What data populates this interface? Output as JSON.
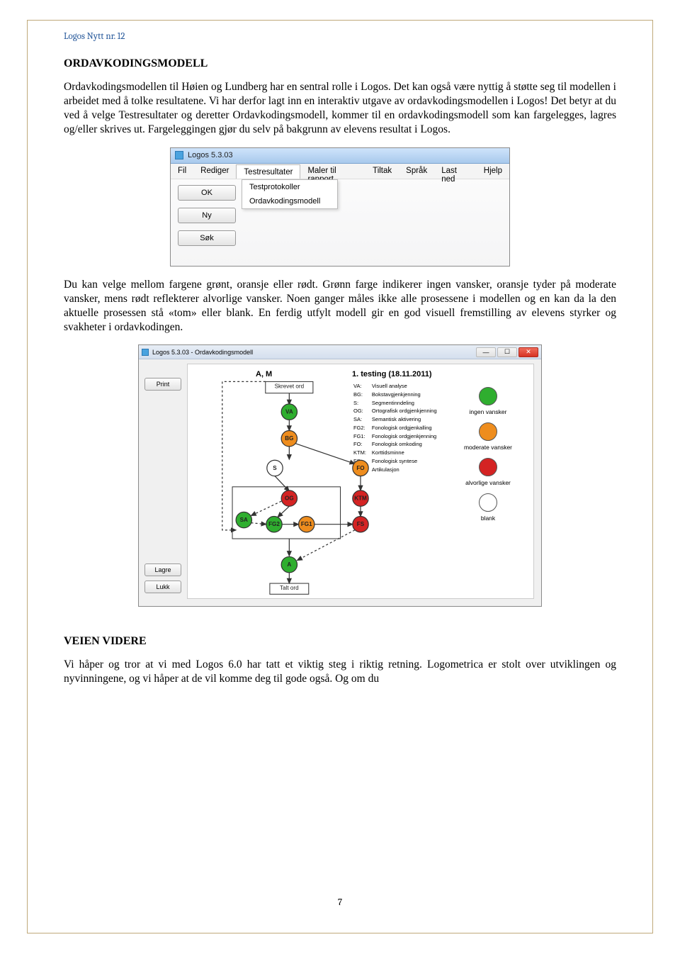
{
  "doc_header": "Logos Nytt nr. 12",
  "page_number": "7",
  "section1_title": "ORDAVKODINGSMODELL",
  "para1": "Ordavkodingsmodellen til Høien og Lundberg har en sentral rolle i Logos. Det kan også være nyttig å støtte seg til modellen i arbeidet med å tolke resultatene. Vi har derfor lagt inn en interaktiv utgave av ordavkodingsmodellen i Logos! Det betyr at du ved å velge Testresultater og deretter Ordavkodingsmodell, kommer til en ordavkodingsmodell som kan fargelegges, lagres og/eller skrives ut. Fargeleggingen gjør du selv på bakgrunn av elevens resultat i Logos.",
  "para2": "Du kan velge mellom fargene grønt, oransje eller rødt. Grønn farge indikerer ingen vansker, oransje tyder på moderate vansker, mens rødt reflekterer alvorlige vansker. Noen ganger måles ikke alle prosessene i modellen og en kan da la den aktuelle prosessen stå «tom» eller blank. En ferdig utfylt modell gir en god visuell fremstilling av elevens styrker og svakheter i ordavkodingen.",
  "section2_title": "VEIEN VIDERE",
  "para3": "Vi håper og tror at vi med Logos 6.0 har tatt et viktig steg i riktig retning. Logometrica er stolt over utviklingen og nyvinningene, og vi håper at de vil komme deg til gode også. Og om du",
  "shot1": {
    "title": "Logos 5.3.03",
    "menu": {
      "fil": "Fil",
      "rediger": "Rediger",
      "testresultater": "Testresultater",
      "maler": "Maler til rapport",
      "tiltak": "Tiltak",
      "sprak": "Språk",
      "lastned": "Last ned",
      "hjelp": "Hjelp"
    },
    "dropdown": {
      "item1": "Testprotokoller",
      "item2": "Ordavkodingsmodell"
    },
    "buttons": {
      "ok": "OK",
      "ny": "Ny",
      "sok": "Søk"
    }
  },
  "shot2": {
    "title": "Logos 5.3.03 - Ordavkodingsmodell",
    "print": "Print",
    "lagre": "Lagre",
    "lukk": "Lukk",
    "student": "A, M",
    "testing": "1. testing (18.11.2011)",
    "skrevet": "Skrevet ord",
    "talt": "Talt ord",
    "legend_keys": {
      "VA": "Visuell analyse",
      "BG": "Bokstavgjenkjenning",
      "S": "Segmentinndeling",
      "OG": "Ortografisk ordgjenkjenning",
      "SA": "Semantisk aktivering",
      "FG2": "Fonologisk ordgjenkalling",
      "FG1": "Fonologisk ordgjenkjenning",
      "FO": "Fonologisk omkoding",
      "KTM": "Korttidsminne",
      "FS": "Fonologisk syntese",
      "A": "Artikulasjon"
    },
    "right_legend": {
      "ingen": "ingen vansker",
      "moderate": "moderate vansker",
      "alvorlige": "alvorlige vansker",
      "blank": "blank"
    },
    "nodes": {
      "VA": "VA",
      "BG": "BG",
      "S": "S",
      "FO": "FO",
      "OG": "OG",
      "KTM": "KTM",
      "SA": "SA",
      "FG2": "FG2",
      "FG1": "FG1",
      "FS": "FS",
      "A": "A"
    }
  },
  "chart_data": {
    "type": "diagram",
    "title": "Ordavkodingsmodell — A, M — 1. testing (18.11.2011)",
    "color_legend": {
      "green": "ingen vansker",
      "orange": "moderate vansker",
      "red": "alvorlige vansker",
      "white": "blank"
    },
    "nodes": [
      {
        "id": "VA",
        "label": "Visuell analyse",
        "color": "green"
      },
      {
        "id": "BG",
        "label": "Bokstavgjenkjenning",
        "color": "orange"
      },
      {
        "id": "S",
        "label": "Segmentinndeling",
        "color": "white"
      },
      {
        "id": "FO",
        "label": "Fonologisk omkoding",
        "color": "orange"
      },
      {
        "id": "OG",
        "label": "Ortografisk ordgjenkjenning",
        "color": "red"
      },
      {
        "id": "KTM",
        "label": "Korttidsminne",
        "color": "red"
      },
      {
        "id": "SA",
        "label": "Semantisk aktivering",
        "color": "green"
      },
      {
        "id": "FG2",
        "label": "Fonologisk ordgjenkalling",
        "color": "green"
      },
      {
        "id": "FG1",
        "label": "Fonologisk ordgjenkjenning",
        "color": "orange"
      },
      {
        "id": "FS",
        "label": "Fonologisk syntese",
        "color": "red"
      },
      {
        "id": "A",
        "label": "Artikulasjon",
        "color": "green"
      }
    ],
    "start_box": "Skrevet ord",
    "end_box": "Talt ord",
    "edges": [
      [
        "Skrevet ord",
        "VA"
      ],
      [
        "VA",
        "BG"
      ],
      [
        "BG",
        "S"
      ],
      [
        "BG",
        "FO"
      ],
      [
        "S",
        "OG"
      ],
      [
        "OG",
        "SA"
      ],
      [
        "OG",
        "FG2"
      ],
      [
        "SA",
        "FG2"
      ],
      [
        "FG2",
        "FG1"
      ],
      [
        "FG1",
        "FS"
      ],
      [
        "FO",
        "KTM"
      ],
      [
        "KTM",
        "FS"
      ],
      [
        "FS",
        "A"
      ],
      [
        "FG2",
        "A"
      ],
      [
        "A",
        "Talt ord"
      ]
    ]
  }
}
